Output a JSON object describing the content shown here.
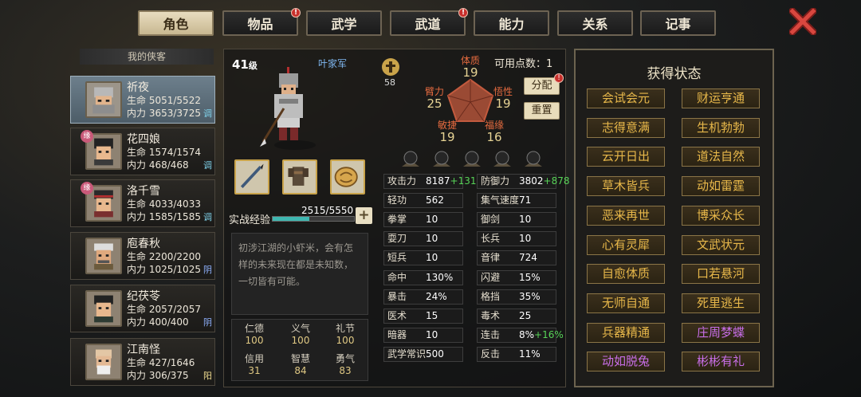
{
  "tabs": [
    {
      "label": "角色",
      "active": true,
      "dot": false
    },
    {
      "label": "物品",
      "active": false,
      "dot": true
    },
    {
      "label": "武学",
      "active": false,
      "dot": false
    },
    {
      "label": "武道",
      "active": false,
      "dot": true
    },
    {
      "label": "能力",
      "active": false,
      "dot": false
    },
    {
      "label": "关系",
      "active": false,
      "dot": false
    },
    {
      "label": "记事",
      "active": false,
      "dot": false
    }
  ],
  "dot_mark": "!",
  "list_title": "我的侠客",
  "hp_label": "生命",
  "mp_label": "内力",
  "characters": [
    {
      "name": "祈夜",
      "hp": "5051/5522",
      "mp": "3653/3725",
      "tag": "调",
      "badge": "",
      "selected": true
    },
    {
      "name": "花四娘",
      "hp": "1574/1574",
      "mp": "468/468",
      "tag": "调",
      "badge": "缘",
      "selected": false
    },
    {
      "name": "洛千雪",
      "hp": "4033/4033",
      "mp": "1585/1585",
      "tag": "调",
      "badge": "缘",
      "selected": false
    },
    {
      "name": "庖春秋",
      "hp": "2200/2200",
      "mp": "1025/1025",
      "tag": "阴",
      "badge": "",
      "selected": false
    },
    {
      "name": "纪茯苓",
      "hp": "2057/2057",
      "mp": "400/400",
      "tag": "阴",
      "badge": "",
      "selected": false
    },
    {
      "name": "江南怪",
      "hp": "427/1646",
      "mp": "306/375",
      "tag": "阳",
      "badge": "",
      "selected": false
    }
  ],
  "profile": {
    "level": "41",
    "level_unit": "级",
    "faction": "叶家军",
    "exp_label": "实战经验",
    "exp_value": "2515/5550",
    "exp_fraction": 0.453,
    "plus": "+",
    "description": "初涉江湖的小虾米，会有怎样的未来现在都是未知数，一切皆有可能。",
    "virtues": [
      {
        "name": "仁德",
        "value": "100"
      },
      {
        "name": "义气",
        "value": "100"
      },
      {
        "name": "礼节",
        "value": "100"
      },
      {
        "name": "信用",
        "value": "31"
      },
      {
        "name": "智慧",
        "value": "84"
      },
      {
        "name": "勇气",
        "value": "83"
      }
    ]
  },
  "wu_value": "58",
  "attributes": {
    "tizhi": {
      "name": "体质",
      "value": "19"
    },
    "bili": {
      "name": "臂力",
      "value": "25"
    },
    "wuxing": {
      "name": "悟性",
      "value": "19"
    },
    "minjie": {
      "name": "敏捷",
      "value": "19"
    },
    "fuyuan": {
      "name": "福缘",
      "value": "16"
    }
  },
  "points_label": "可用点数：",
  "points_value": "1",
  "allocate_label": "分配",
  "reset_label": "重置",
  "stats_left": [
    {
      "label": "攻击力",
      "value": "8187",
      "bonus": "+1310"
    },
    {
      "label": "轻功",
      "value": "562",
      "bonus": ""
    },
    {
      "label": "拳掌",
      "value": "10",
      "bonus": ""
    },
    {
      "label": "耍刀",
      "value": "10",
      "bonus": ""
    },
    {
      "label": "短兵",
      "value": "10",
      "bonus": ""
    },
    {
      "label": "命中",
      "value": "130%",
      "bonus": ""
    },
    {
      "label": "暴击",
      "value": "24%",
      "bonus": ""
    },
    {
      "label": "医术",
      "value": "15",
      "bonus": ""
    },
    {
      "label": "暗器",
      "value": "10",
      "bonus": ""
    },
    {
      "label": "武学常识",
      "value": "500",
      "bonus": ""
    }
  ],
  "stats_right": [
    {
      "label": "防御力",
      "value": "3802",
      "bonus": "+878"
    },
    {
      "label": "集气速度",
      "value": "71",
      "bonus": ""
    },
    {
      "label": "御剑",
      "value": "10",
      "bonus": ""
    },
    {
      "label": "长兵",
      "value": "10",
      "bonus": ""
    },
    {
      "label": "音律",
      "value": "724",
      "bonus": ""
    },
    {
      "label": "闪避",
      "value": "15%",
      "bonus": ""
    },
    {
      "label": "格挡",
      "value": "35%",
      "bonus": ""
    },
    {
      "label": "毒术",
      "value": "25",
      "bonus": ""
    },
    {
      "label": "连击",
      "value": "8%",
      "bonus": "+16%"
    },
    {
      "label": "反击",
      "value": "11%",
      "bonus": ""
    }
  ],
  "status_title": "获得状态",
  "statuses": [
    {
      "label": "会试会元",
      "color": "gold"
    },
    {
      "label": "财运亨通",
      "color": "gold"
    },
    {
      "label": "志得意满",
      "color": "gold"
    },
    {
      "label": "生机勃勃",
      "color": "gold"
    },
    {
      "label": "云开日出",
      "color": "gold"
    },
    {
      "label": "道法自然",
      "color": "gold"
    },
    {
      "label": "草木皆兵",
      "color": "gold"
    },
    {
      "label": "动如雷霆",
      "color": "gold"
    },
    {
      "label": "恶来再世",
      "color": "gold"
    },
    {
      "label": "博采众长",
      "color": "gold"
    },
    {
      "label": "心有灵犀",
      "color": "gold"
    },
    {
      "label": "文武状元",
      "color": "gold"
    },
    {
      "label": "自愈体质",
      "color": "gold"
    },
    {
      "label": "口若悬河",
      "color": "gold"
    },
    {
      "label": "无师自通",
      "color": "gold"
    },
    {
      "label": "死里逃生",
      "color": "gold"
    },
    {
      "label": "兵器精通",
      "color": "gold"
    },
    {
      "label": "庄周梦蝶",
      "color": "purple"
    },
    {
      "label": "动如脱兔",
      "color": "purple"
    },
    {
      "label": "彬彬有礼",
      "color": "purple"
    }
  ],
  "colors": {
    "gold": "#e8b84a",
    "purple": "#c86ee8",
    "bonus": "#57d357",
    "accent": "#e46a3f"
  }
}
